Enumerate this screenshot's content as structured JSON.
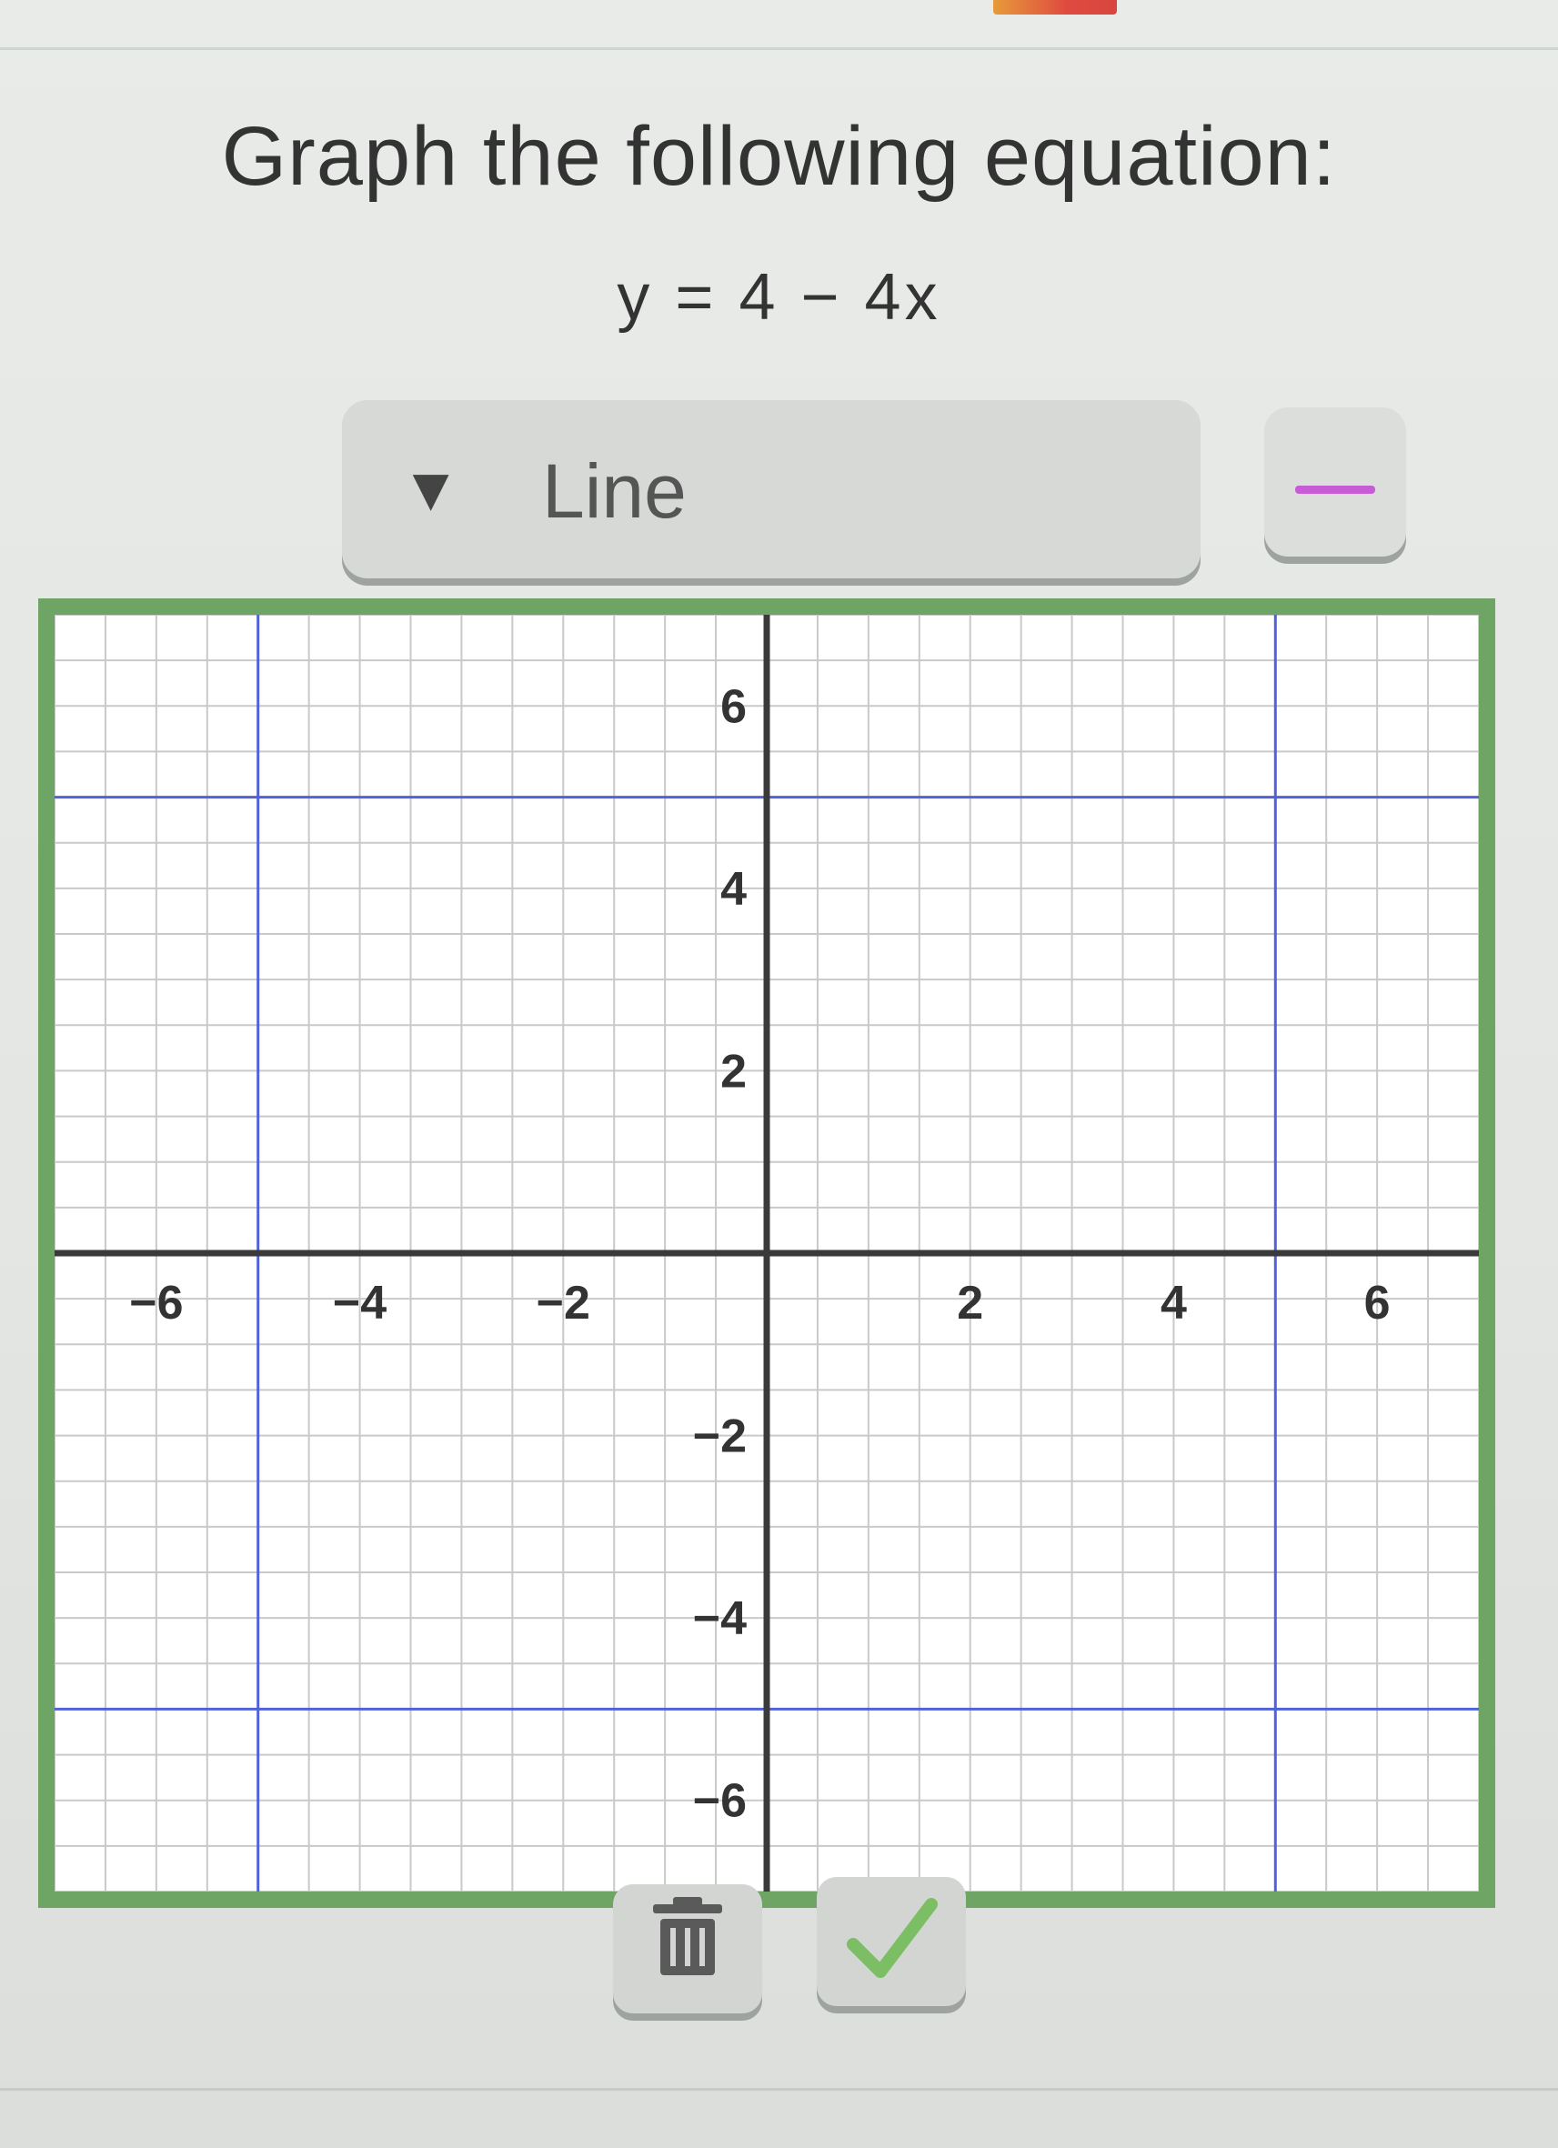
{
  "prompt": "Graph the following equation:",
  "equation": "y = 4 − 4x",
  "tool": {
    "label": "Line",
    "caret_icon": "▼"
  },
  "color_swatch": "#c85bd6",
  "colors": {
    "panel_border": "#6ea464",
    "grid_line": "#c9c9c9",
    "axis_line": "#3a3a3a",
    "guide_line": "#4f62d8",
    "check": "#7cbe63"
  },
  "buttons": {
    "trash_icon": "trash-icon",
    "check_icon": "check-icon"
  },
  "chart_data": {
    "type": "line",
    "xlim": [
      -7,
      7
    ],
    "ylim": [
      -7,
      7
    ],
    "grid": true,
    "x_ticks": [
      -6,
      -4,
      -2,
      2,
      4,
      6
    ],
    "y_ticks": [
      6,
      4,
      2,
      -2,
      -4,
      -6
    ],
    "guide_lines": {
      "vertical_x": [
        -5,
        5
      ],
      "horizontal_y": [
        5,
        -5
      ]
    }
  }
}
